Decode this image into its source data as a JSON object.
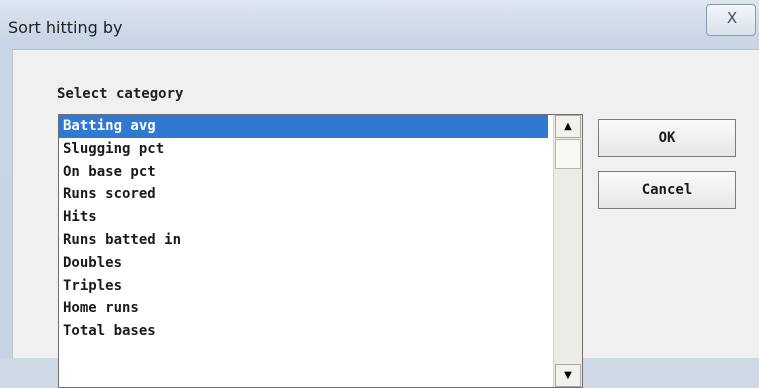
{
  "window": {
    "title": "Sort hitting by",
    "close_label": "☒"
  },
  "dialog": {
    "category_label": "Select category",
    "categories": [
      {
        "label": "Batting avg",
        "selected": true
      },
      {
        "label": "Slugging pct",
        "selected": false
      },
      {
        "label": "On base pct",
        "selected": false
      },
      {
        "label": "Runs scored",
        "selected": false
      },
      {
        "label": "Hits",
        "selected": false
      },
      {
        "label": "Runs batted in",
        "selected": false
      },
      {
        "label": "Doubles",
        "selected": false
      },
      {
        "label": "Triples",
        "selected": false
      },
      {
        "label": "Home runs",
        "selected": false
      },
      {
        "label": "Total bases",
        "selected": false
      }
    ],
    "ok_label": "OK",
    "cancel_label": "Cancel",
    "scroll_up_glyph": "▲",
    "scroll_down_glyph": "▼"
  },
  "colors": {
    "selection": "#2f7ad0",
    "title_bar": "#c9d6e5"
  }
}
